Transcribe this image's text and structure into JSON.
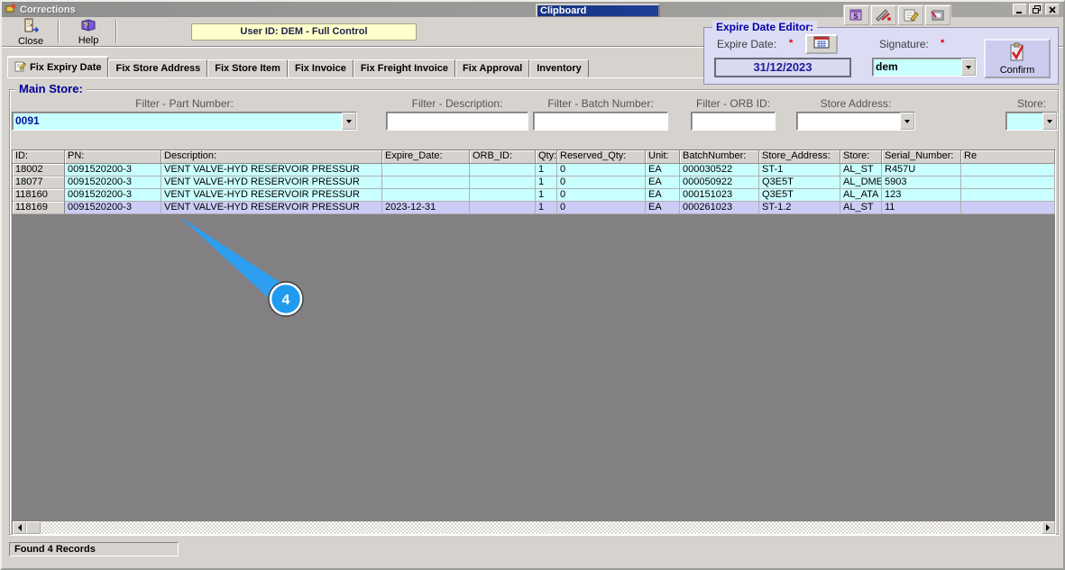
{
  "window": {
    "title": "Corrections",
    "clipboard_label": "Clipboard"
  },
  "toolbar": {
    "close_label": "Close",
    "help_label": "Help",
    "user_banner": "User ID: DEM - Full Control"
  },
  "expire_editor": {
    "title": "Expire Date Editor:",
    "expire_date_label": "Expire Date:",
    "required_marker": "*",
    "date_value": "31/12/2023",
    "signature_label": "Signature:",
    "signature_value": "dem",
    "confirm_label": "Confirm"
  },
  "tabs": [
    {
      "label": "Fix Expiry Date",
      "active": true
    },
    {
      "label": "Fix Store Address",
      "active": false
    },
    {
      "label": "Fix Store Item",
      "active": false
    },
    {
      "label": "Fix Invoice",
      "active": false
    },
    {
      "label": "Fix Freight Invoice",
      "active": false
    },
    {
      "label": "Fix Approval",
      "active": false
    },
    {
      "label": "Inventory",
      "active": false
    }
  ],
  "main": {
    "group_title": "Main Store:",
    "filters": [
      {
        "label": "Filter - Part Number:",
        "value": "0091",
        "kind": "combo-cyan"
      },
      {
        "label": "Filter - Description:",
        "value": "",
        "kind": "text"
      },
      {
        "label": "Filter - Batch Number:",
        "value": "",
        "kind": "text"
      },
      {
        "label": "Filter - ORB ID:",
        "value": "",
        "kind": "text"
      },
      {
        "label": "Store Address:",
        "value": "",
        "kind": "combo-white"
      },
      {
        "label": "Store:",
        "value": "",
        "kind": "combo-cyan"
      }
    ],
    "table": {
      "columns": [
        "ID:",
        "PN:",
        "Description:",
        "Expire_Date:",
        "ORB_ID:",
        "Qty:",
        "Reserved_Qty:",
        "Unit:",
        "BatchNumber:",
        "Store_Address:",
        "Store:",
        "Serial_Number:",
        "Re"
      ],
      "rows": [
        [
          "18002",
          "0091520200-3",
          "VENT VALVE-HYD RESERVOIR PRESSUR",
          "",
          "",
          "1",
          "0",
          "EA",
          "000030522",
          "ST-1",
          "AL_ST",
          "R457U",
          ""
        ],
        [
          "18077",
          "0091520200-3",
          "VENT VALVE-HYD RESERVOIR PRESSUR",
          "",
          "",
          "1",
          "0",
          "EA",
          "000050922",
          "Q3E5T",
          "AL_DME",
          "5903",
          ""
        ],
        [
          "118160",
          "0091520200-3",
          "VENT VALVE-HYD RESERVOIR PRESSUR",
          "",
          "",
          "1",
          "0",
          "EA",
          "000151023",
          "Q3E5T",
          "AL_ATA",
          "123",
          ""
        ],
        [
          "118169",
          "0091520200-3",
          "VENT VALVE-HYD RESERVOIR PRESSUR",
          "2023-12-31",
          "",
          "1",
          "0",
          "EA",
          "000261023",
          "ST-1.2",
          "AL_ST",
          "11",
          ""
        ]
      ],
      "selected_row_index": 3
    },
    "status_text": "Found 4 Records"
  },
  "annotation": {
    "number": "4"
  },
  "icons": {
    "mini_buttons": [
      "clipboard-save-icon",
      "utilities-icon",
      "edit-pad-icon",
      "book-print-icon"
    ]
  },
  "colors": {
    "row_cyan": "#caffff",
    "row_selected": "#ccccf7",
    "callout_blue": "#1f9bef",
    "panel_lavender": "#dcdcf4",
    "banner_yellow": "#ffffc9",
    "title_navy": "#000099"
  }
}
